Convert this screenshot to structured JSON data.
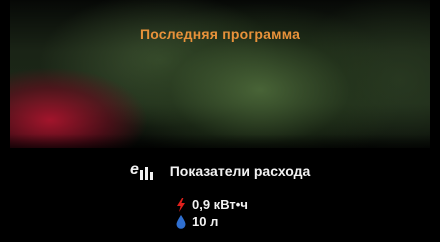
{
  "screen": {
    "title": "Последняя программа"
  },
  "consumption": {
    "header_label": "Показатели расхода",
    "header_icon": "eco-bars-icon",
    "energy": {
      "icon": "lightning-icon",
      "color": "#e0201c",
      "value": "0,9 кВт•ч"
    },
    "water": {
      "icon": "water-drop-icon",
      "color": "#2f6fd0",
      "value": "10 л"
    }
  }
}
